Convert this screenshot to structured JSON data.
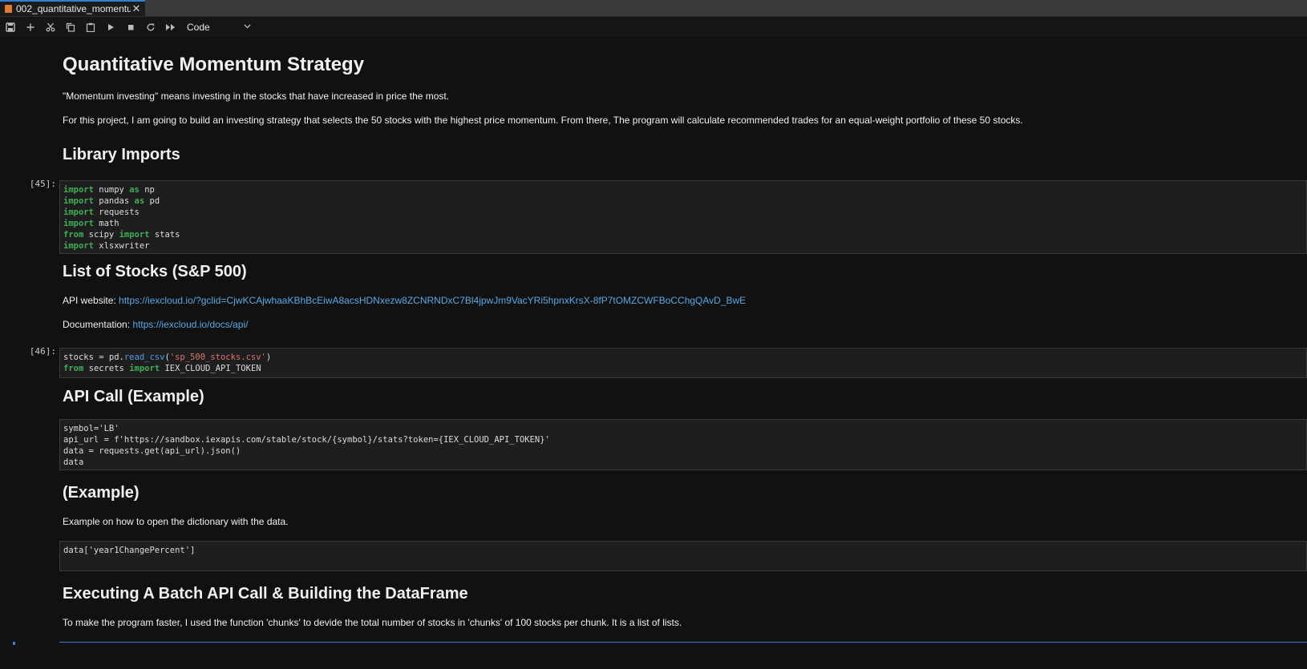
{
  "tab": {
    "title": "002_quantitative_momentu",
    "close": "✕"
  },
  "toolbar": {
    "icons": [
      "save-icon",
      "add-cell-icon",
      "cut-icon",
      "copy-icon",
      "paste-icon",
      "run-icon",
      "stop-icon",
      "restart-icon",
      "run-all-icon"
    ],
    "cell_type": "Code"
  },
  "cells": {
    "title": "Quantitative Momentum Strategy",
    "intro1": "\"Momentum investing\" means investing in the stocks that have increased in price the most.",
    "intro2": "For this project, I am going to build an investing strategy that selects the 50 stocks with the highest price momentum. From there, The program will calculate recommended trades for an equal-weight portfolio of these 50 stocks.",
    "h_imports": "Library Imports",
    "prompt_imports": "[45]:",
    "h_stocks": "List of Stocks (S&P 500)",
    "api_label": "API website: ",
    "api_link": "https://iexcloud.io/?gclid=CjwKCAjwhaaKBhBcEiwA8acsHDNxezw8ZCNRNDxC7Bl4jpwJm9VacYRi5hpnxKrsX-8fP7tOMZCWFBoCChgQAvD_BwE",
    "doc_label": "Documentation: ",
    "doc_link": "https://iexcloud.io/docs/api/",
    "prompt_stocks": "[46]:",
    "h_apicall": "API Call (Example)",
    "h_example": "(Example)",
    "example_text": "Example on how to open the dictionary with the data.",
    "h_batch": "Executing A Batch API Call & Building the DataFrame",
    "batch_text": "To make the program faster, I used the function 'chunks' to devide the total number of stocks in 'chunks' of 100 stocks per chunk. It is a list of lists."
  },
  "code": {
    "imports": [
      [
        [
          "kw",
          "import"
        ],
        [
          "",
          "numpy"
        ],
        [
          "kw",
          "as"
        ],
        [
          "",
          "np"
        ]
      ],
      [
        [
          "kw",
          "import"
        ],
        [
          "",
          "pandas"
        ],
        [
          "kw",
          "as"
        ],
        [
          "",
          "pd"
        ]
      ],
      [
        [
          "kw",
          "import"
        ],
        [
          "",
          "requests"
        ]
      ],
      [
        [
          "kw",
          "import"
        ],
        [
          "",
          "math"
        ]
      ],
      [
        [
          "kw",
          "from"
        ],
        [
          "",
          "scipy"
        ],
        [
          "kw",
          "import"
        ],
        [
          "",
          "stats"
        ]
      ],
      [
        [
          "kw",
          "import"
        ],
        [
          "",
          "xlsxwriter"
        ]
      ]
    ],
    "stocks_line1": {
      "a": "stocks = pd.",
      "fn": "read_csv",
      "b": "(",
      "str": "'sp_500_stocks.csv'",
      "c": ")"
    },
    "stocks_line2": {
      "kw1": "from",
      "mod": "secrets",
      "kw2": "import",
      "name": "IEX_CLOUD_API_TOKEN"
    },
    "apicall": "symbol='LB'\napi_url = f'https://sandbox.iexapis.com/stable/stock/{symbol}/stats?token={IEX_CLOUD_API_TOKEN}'\ndata = requests.get(api_url).json()\ndata",
    "example": "data['year1ChangePercent']"
  }
}
